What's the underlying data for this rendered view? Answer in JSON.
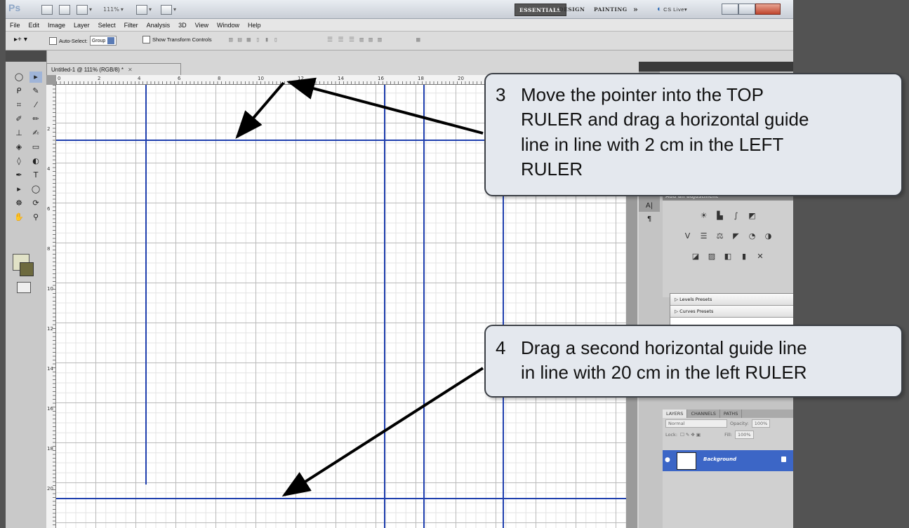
{
  "titlebar": {
    "app_logo": "Ps",
    "zoom_value": "111%",
    "workspaces": [
      "ESSENTIALS",
      "DESIGN",
      "PAINTING",
      "»"
    ],
    "cslive": "CS Live"
  },
  "menu": [
    "File",
    "Edit",
    "Image",
    "Layer",
    "Select",
    "Filter",
    "Analysis",
    "3D",
    "View",
    "Window",
    "Help"
  ],
  "options": {
    "auto_select_label": "Auto-Select:",
    "auto_select_value": "Group",
    "show_transform_label": "Show Transform Controls"
  },
  "document": {
    "tab_title": "Untitled-1 @ 111% (RGB/8) *",
    "top_ruler_labels": [
      "0",
      "2",
      "4",
      "6",
      "8",
      "10",
      "12",
      "14",
      "16",
      "18",
      "20"
    ],
    "left_ruler_labels": [
      "2",
      "4",
      "6",
      "8",
      "10",
      "12",
      "14",
      "16",
      "18",
      "20"
    ]
  },
  "panels": {
    "adjustments_title": "Add an adjustment",
    "presets": [
      "Levels Presets",
      "Curves Presets"
    ],
    "layer_tabs": [
      "LAYERS",
      "CHANNELS",
      "PATHS"
    ],
    "blend_mode": "Normal",
    "opacity_label": "Opacity:",
    "opacity_value": "100%",
    "lock_label": "Lock:",
    "fill_label": "Fill:",
    "fill_value": "100%",
    "layer_name": "Background"
  },
  "callouts": {
    "step3_num": "3",
    "step3_lines": [
      "Move the pointer into the TOP",
      "RULER and drag a horizontal guide",
      "line in line with 2 cm in the LEFT",
      "RULER"
    ],
    "step4_num": "4",
    "step4_lines": [
      "Drag a second horizontal guide line",
      "in line with 20 cm in the left RULER"
    ]
  },
  "colors": {
    "guide": "#1f3fae",
    "callout_bg": "#e4e8ee",
    "layer_selected": "#3c66c6",
    "foreground_swatch": "#e1e2c7",
    "background_swatch": "#6d6a3e"
  }
}
